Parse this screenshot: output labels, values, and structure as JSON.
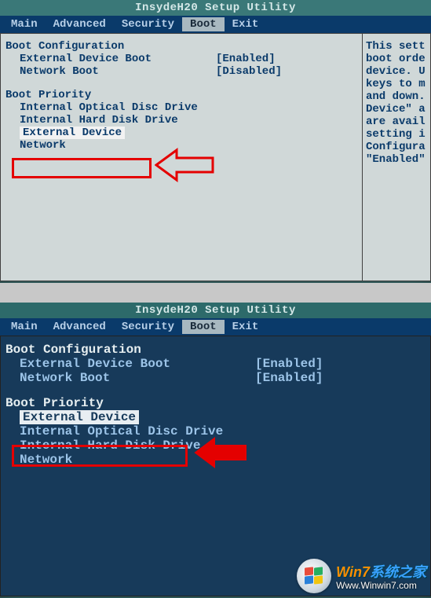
{
  "bios1": {
    "title": "InsydeH20 Setup Utility",
    "menu": [
      "Main",
      "Advanced",
      "Security",
      "Boot",
      "Exit"
    ],
    "activeMenu": 3,
    "section_config": "Boot Configuration",
    "options": [
      {
        "label": "External Device Boot",
        "value": "[Enabled]"
      },
      {
        "label": "Network Boot",
        "value": "[Disabled]"
      }
    ],
    "section_priority": "Boot Priority",
    "priority": [
      "Internal Optical Disc Drive",
      "Internal Hard Disk Drive",
      "External Device",
      "Network"
    ],
    "selectedPriorityIndex": 2,
    "help": "This sett\nboot orde\ndevice. U\nkeys to m\nand down.\nDevice\" a\nare avail\nsetting i\nConfigura\n\"Enabled\""
  },
  "bios2": {
    "title": "InsydeH20 Setup Utility",
    "menu": [
      "Main",
      "Advanced",
      "Security",
      "Boot",
      "Exit"
    ],
    "activeMenu": 3,
    "section_config": "Boot Configuration",
    "options": [
      {
        "label": "External Device Boot",
        "value": "[Enabled]"
      },
      {
        "label": "Network Boot",
        "value": "[Enabled]"
      }
    ],
    "section_priority": "Boot Priority",
    "priority": [
      "External Device",
      "Internal Optical Disc Drive",
      "Internal Hard Disk Drive",
      "Network"
    ],
    "selectedPriorityIndex": 0
  },
  "watermark": {
    "line1a": "Win7",
    "line1b": "系统之家",
    "line2": "Www.Winwin7.com"
  },
  "colors": {
    "annotation_red": "#e40000",
    "bios_bg_light": "#d0d8d8",
    "bios_bg_dark": "#173a5a",
    "menu_bg": "#0a3a6a"
  }
}
